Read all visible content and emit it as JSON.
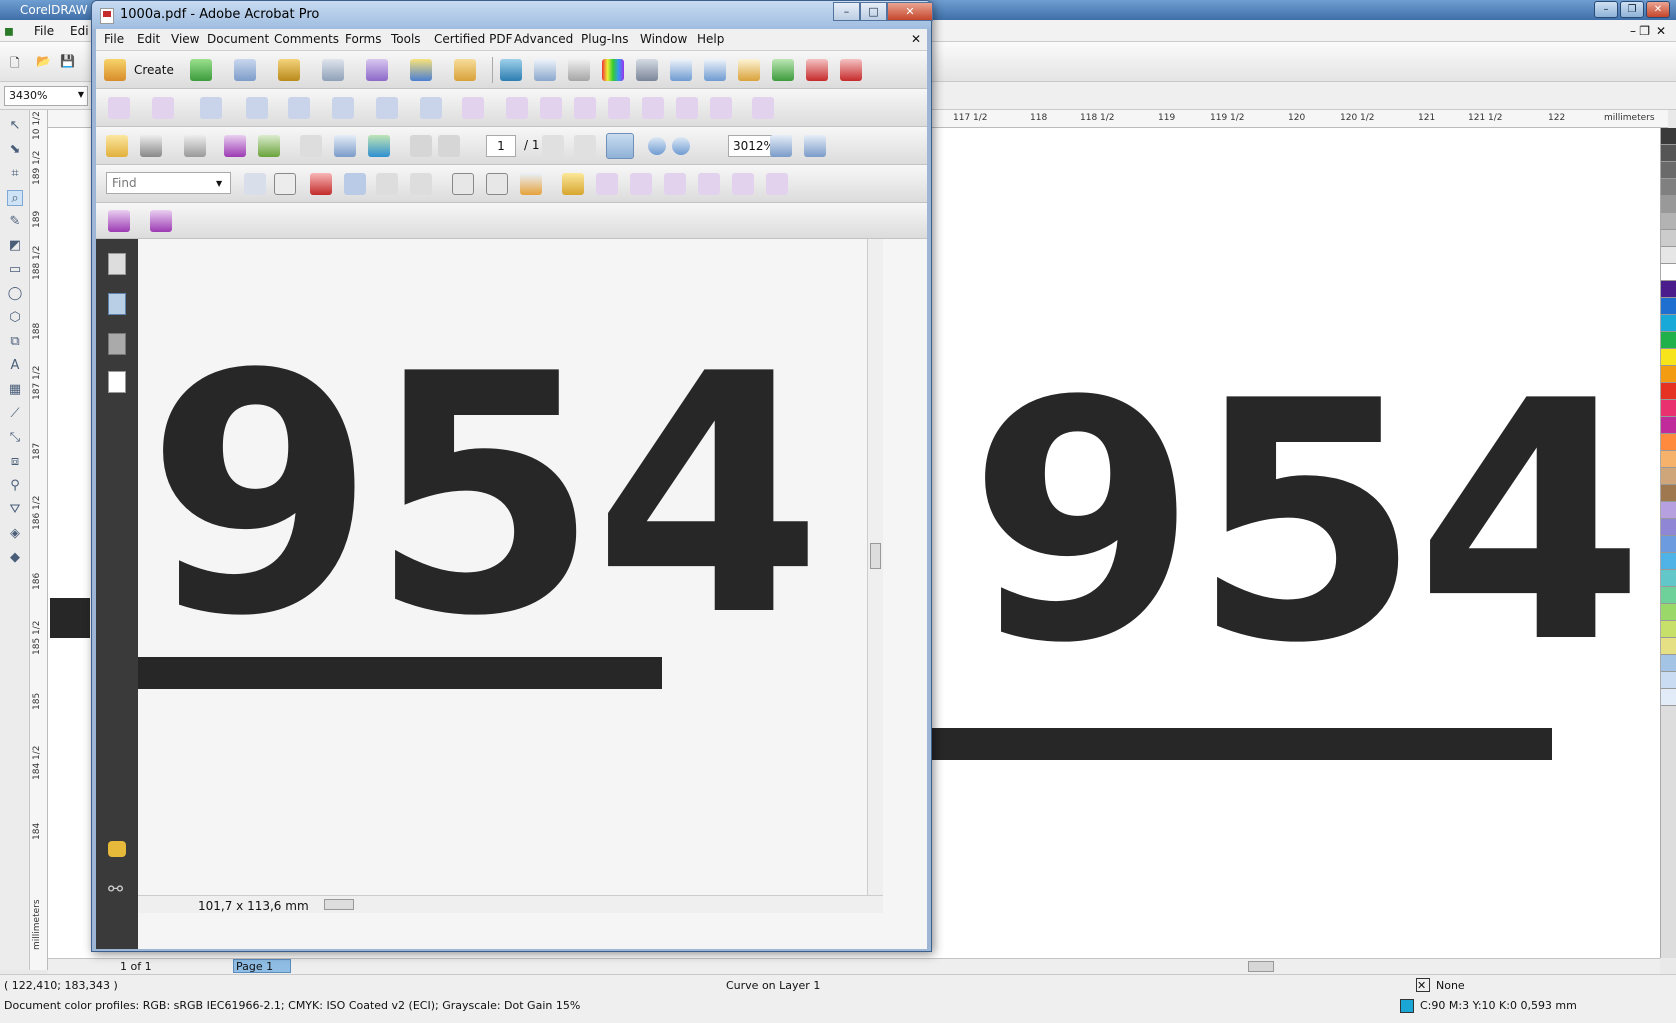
{
  "corel": {
    "title": "CorelDRAW",
    "menu": {
      "file": "File",
      "edit": "Edi"
    },
    "zoom": "3430%",
    "ruler_unit": "millimeters",
    "hruler_labels": [
      "117 1/2",
      "118",
      "118 1/2",
      "119",
      "119 1/2",
      "120",
      "120 1/2",
      "121",
      "121 1/2",
      "122"
    ],
    "vruler_labels": [
      "10 1/2",
      "189 1/2",
      "189",
      "188 1/2",
      "188",
      "187 1/2",
      "187",
      "186 1/2",
      "186",
      "185 1/2",
      "185",
      "184 1/2",
      "184"
    ],
    "page_count": "1 of 1",
    "page_tab": "Page 1",
    "cursor_pos": "( 122,410; 183,343 )",
    "object_info": "Curve on Layer 1",
    "fill_none": "None",
    "color_profiles": "Document color profiles: RGB: sRGB IEC61966-2.1; CMYK: ISO Coated v2 (ECI); Grayscale: Dot Gain 15%",
    "outline_info": "C:90 M:3 Y:10 K:0  0,593 mm",
    "canvas_text": "954",
    "palette": [
      "#3a3a3a",
      "#555",
      "#6a6a6a",
      "#808080",
      "#999",
      "#b3b3b3",
      "#ccc",
      "#e6e6e6",
      "#ffffff",
      "#4b1c8c",
      "#1f6fd1",
      "#18a9d8",
      "#20b14a",
      "#f7e41a",
      "#f39c12",
      "#e63222",
      "#e8316e",
      "#c12a9b",
      "#ff8a3d",
      "#f6b26b",
      "#cfa67a",
      "#a07850",
      "#b6a0e0",
      "#8f86d6",
      "#6d9be0",
      "#4fb3e8",
      "#61c7c9",
      "#6fd19a",
      "#9ad86a",
      "#c6e06a",
      "#e5e083",
      "#a3c4e4",
      "#c9dcf1",
      "#e2ecf8"
    ]
  },
  "acrobat": {
    "title": "1000a.pdf - Adobe Acrobat Pro",
    "menu": [
      "File",
      "Edit",
      "View",
      "Document",
      "Comments",
      "Forms",
      "Tools",
      "Certified PDF",
      "Advanced",
      "Plug-Ins",
      "Window",
      "Help"
    ],
    "create_label": "Create",
    "page_current": "1",
    "page_total": "/ 1",
    "zoom": "3012%",
    "find_placeholder": "Find",
    "doc_size": "101,7 x 113,6 mm",
    "doc_text": "954"
  }
}
